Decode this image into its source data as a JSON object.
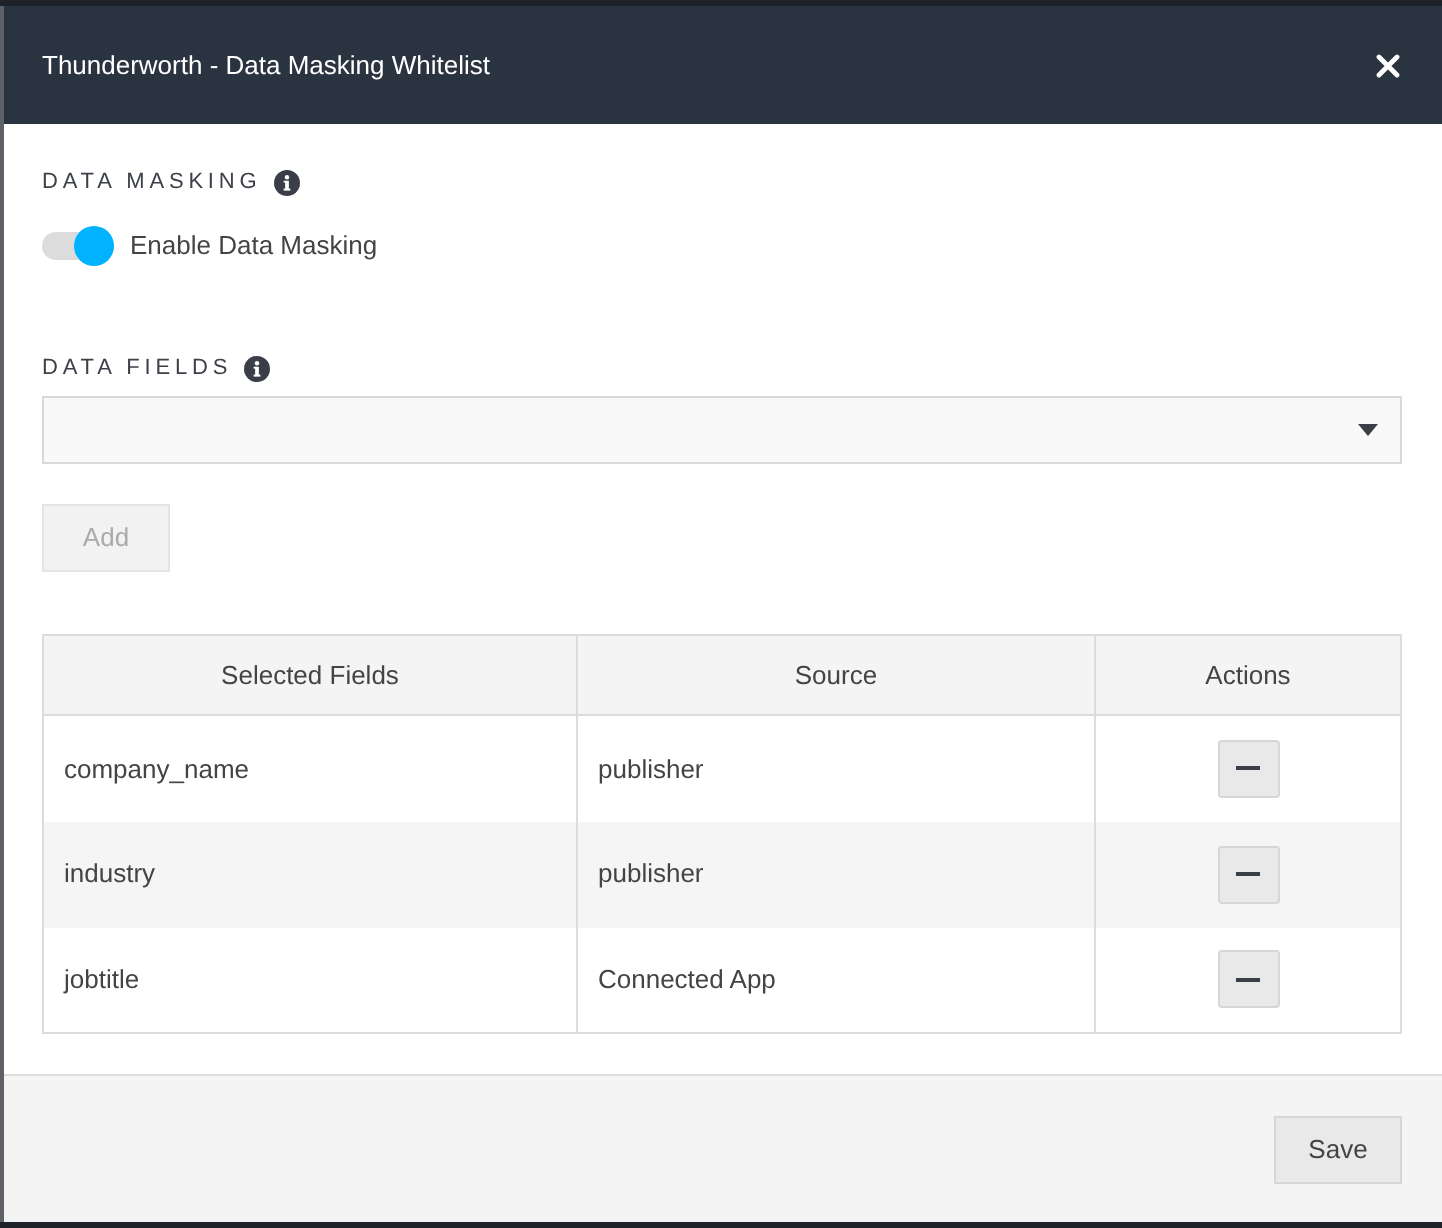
{
  "dialog": {
    "title": "Thunderworth - Data Masking Whitelist"
  },
  "data_masking": {
    "label": "DATA MASKING",
    "toggle": {
      "label": "Enable Data Masking",
      "on": true
    }
  },
  "data_fields": {
    "label": "DATA FIELDS",
    "add_button": {
      "label": "Add",
      "disabled": true
    }
  },
  "table": {
    "columns": [
      "Selected Fields",
      "Source",
      "Actions"
    ],
    "rows": [
      {
        "field": "company_name",
        "source": "publisher"
      },
      {
        "field": "industry",
        "source": "publisher"
      },
      {
        "field": "jobtitle",
        "source": "Connected App"
      }
    ]
  },
  "footer": {
    "buttons": [
      "Save"
    ]
  }
}
